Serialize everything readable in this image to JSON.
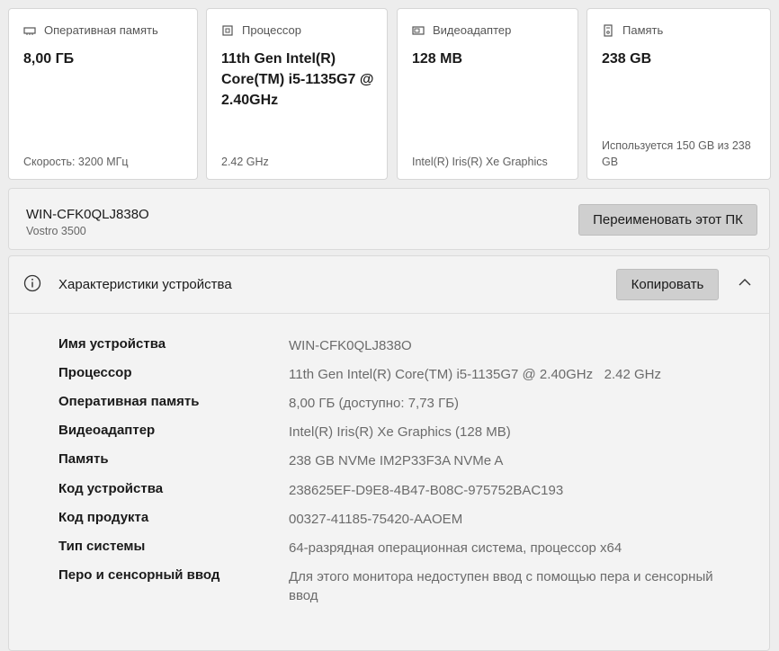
{
  "cards": [
    {
      "title": "Оперативная память",
      "value": "8,00 ГБ",
      "sub": "Скорость: 3200 МГц",
      "icon": "ram-icon"
    },
    {
      "title": "Процессор",
      "value": "11th Gen Intel(R) Core(TM) i5-1135G7 @ 2.40GHz",
      "sub": "2.42 GHz",
      "icon": "cpu-icon"
    },
    {
      "title": "Видеоадаптер",
      "value": "128 MB",
      "sub": "Intel(R) Iris(R) Xe Graphics",
      "icon": "gpu-icon"
    },
    {
      "title": "Память",
      "value": "238 GB",
      "sub": "Используется 150 GB из 238 GB",
      "icon": "storage-icon"
    }
  ],
  "device": {
    "name": "WIN-CFK0QLJ838O",
    "model": "Vostro 3500",
    "rename_label": "Переименовать этот ПК"
  },
  "specs": {
    "title": "Характеристики устройства",
    "copy_label": "Копировать",
    "rows": [
      {
        "key": "Имя устройства",
        "value": "WIN-CFK0QLJ838O"
      },
      {
        "key": "Процессор",
        "value": "11th Gen Intel(R) Core(TM) i5-1135G7 @ 2.40GHz   2.42 GHz"
      },
      {
        "key": "Оперативная память",
        "value": "8,00 ГБ (доступно: 7,73 ГБ)"
      },
      {
        "key": "Видеоадаптер",
        "value": "Intel(R) Iris(R) Xe Graphics (128 MB)"
      },
      {
        "key": "Память",
        "value": "238 GB NVMe IM2P33F3A NVMe A"
      },
      {
        "key": "Код устройства",
        "value": "238625EF-D9E8-4B47-B08C-975752BAC193"
      },
      {
        "key": "Код продукта",
        "value": "00327-41185-75420-AAOEM"
      },
      {
        "key": "Тип системы",
        "value": "64-разрядная операционная система, процессор x64"
      },
      {
        "key": "Перо и сенсорный ввод",
        "value": "Для этого монитора недоступен ввод с помощью пера и сенсорный ввод"
      }
    ]
  }
}
